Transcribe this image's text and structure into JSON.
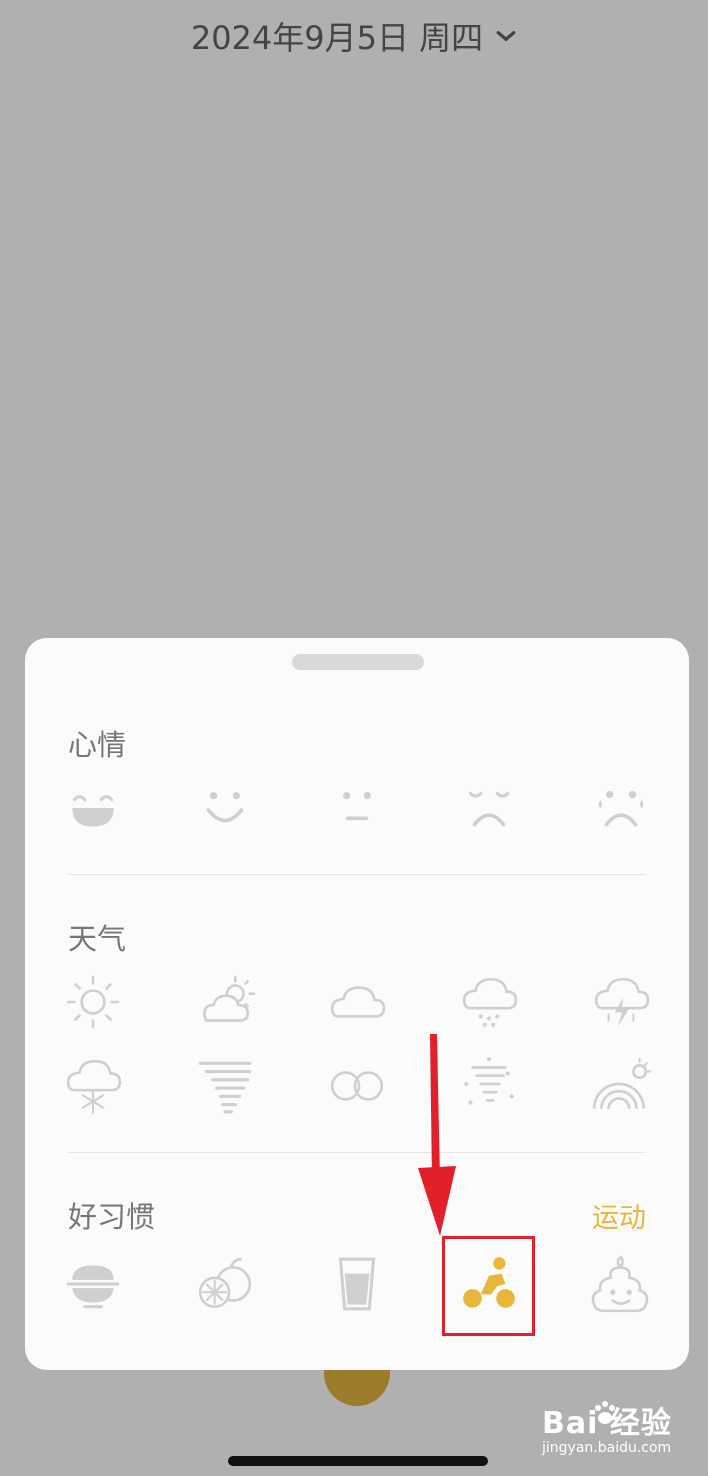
{
  "header": {
    "date_label": "2024年9月5日 周四"
  },
  "sheet": {
    "mood": {
      "title": "心情",
      "icons": [
        "laughing-face-icon",
        "smiling-face-icon",
        "neutral-face-icon",
        "sad-face-icon",
        "crying-face-icon"
      ]
    },
    "weather": {
      "title": "天气",
      "icons": [
        "sun-icon",
        "partly-cloudy-icon",
        "cloud-icon",
        "rain-icon",
        "thunderstorm-icon",
        "snow-icon",
        "wind-icon",
        "fog-icon",
        "tornado-icon",
        "rainbow-icon"
      ]
    },
    "habits": {
      "title": "好习惯",
      "selected_label": "运动",
      "icons": [
        "meal-bowl-icon",
        "fruit-icon",
        "water-glass-icon",
        "cycling-icon",
        "poop-icon"
      ]
    }
  },
  "colors": {
    "accent": "#e9b63c",
    "icon_gray": "#cfcfcf",
    "annotation_red": "#e2202b"
  },
  "watermark": {
    "brand": "Bai  经验",
    "url": "jingyan.baidu.com"
  }
}
